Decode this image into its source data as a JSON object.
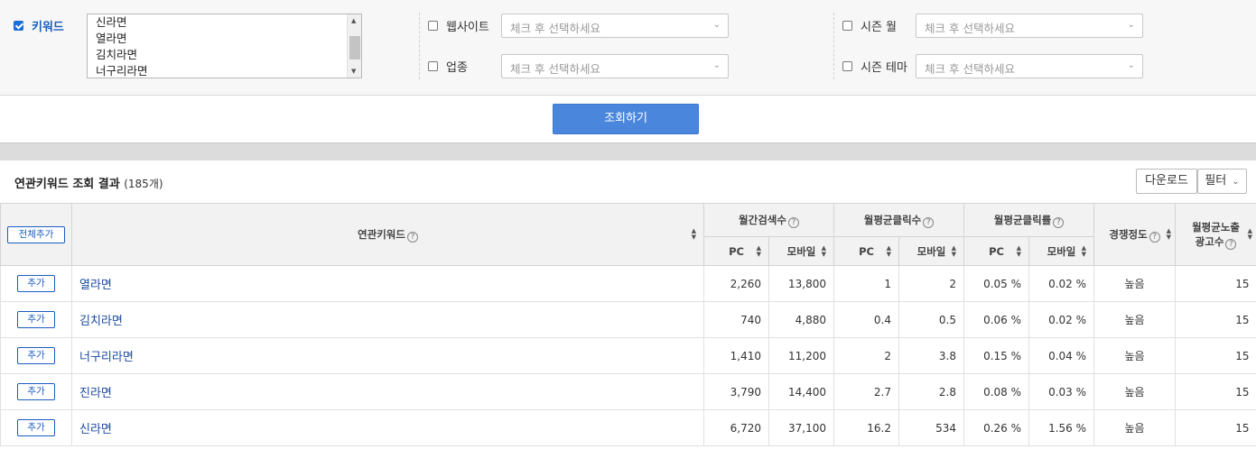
{
  "filters": {
    "keyword": {
      "label": "키워드",
      "checked": true,
      "values": [
        "신라면",
        "열라면",
        "김치라면",
        "너구리라면"
      ]
    },
    "website": {
      "label": "웹사이트",
      "checked": false,
      "placeholder": "체크 후 선택하세요"
    },
    "industry": {
      "label": "업종",
      "checked": false,
      "placeholder": "체크 후 선택하세요"
    },
    "season_month": {
      "label": "시즌 월",
      "checked": false,
      "placeholder": "체크 후 선택하세요"
    },
    "season_theme": {
      "label": "시즌 테마",
      "checked": false,
      "placeholder": "체크 후 선택하세요"
    }
  },
  "search_button": "조회하기",
  "results": {
    "title": "연관키워드 조회 결과",
    "count": "(185개)",
    "download_label": "다운로드",
    "filter_label": "필터"
  },
  "table": {
    "headers": {
      "add_all": "전체추가",
      "keyword": "연관키워드",
      "monthly_search": "월간검색수",
      "avg_clicks": "월평균클릭수",
      "avg_ctr": "월평균클릭률",
      "competition": "경쟁정도",
      "ad_count_line1": "월평균노출",
      "ad_count_line2": "광고수",
      "pc": "PC",
      "mobile": "모바일"
    },
    "add_label": "추가",
    "rows": [
      {
        "keyword": "열라면",
        "search_pc": "2,260",
        "search_mobile": "13,800",
        "clicks_pc": "1",
        "clicks_mobile": "2",
        "ctr_pc": "0.05 %",
        "ctr_mobile": "0.02 %",
        "competition": "높음",
        "ads": "15"
      },
      {
        "keyword": "김치라면",
        "search_pc": "740",
        "search_mobile": "4,880",
        "clicks_pc": "0.4",
        "clicks_mobile": "0.5",
        "ctr_pc": "0.06 %",
        "ctr_mobile": "0.02 %",
        "competition": "높음",
        "ads": "15"
      },
      {
        "keyword": "너구리라면",
        "search_pc": "1,410",
        "search_mobile": "11,200",
        "clicks_pc": "2",
        "clicks_mobile": "3.8",
        "ctr_pc": "0.15 %",
        "ctr_mobile": "0.04 %",
        "competition": "높음",
        "ads": "15"
      },
      {
        "keyword": "진라면",
        "search_pc": "3,790",
        "search_mobile": "14,400",
        "clicks_pc": "2.7",
        "clicks_mobile": "2.8",
        "ctr_pc": "0.08 %",
        "ctr_mobile": "0.03 %",
        "competition": "높음",
        "ads": "15"
      },
      {
        "keyword": "신라면",
        "search_pc": "6,720",
        "search_mobile": "37,100",
        "clicks_pc": "16.2",
        "clicks_mobile": "534",
        "ctr_pc": "0.26 %",
        "ctr_mobile": "1.56 %",
        "competition": "높음",
        "ads": "15"
      }
    ]
  },
  "colors": {
    "accent": "#4a86dc",
    "link": "#1a4a9c",
    "header_bg": "#f2f2f2"
  }
}
